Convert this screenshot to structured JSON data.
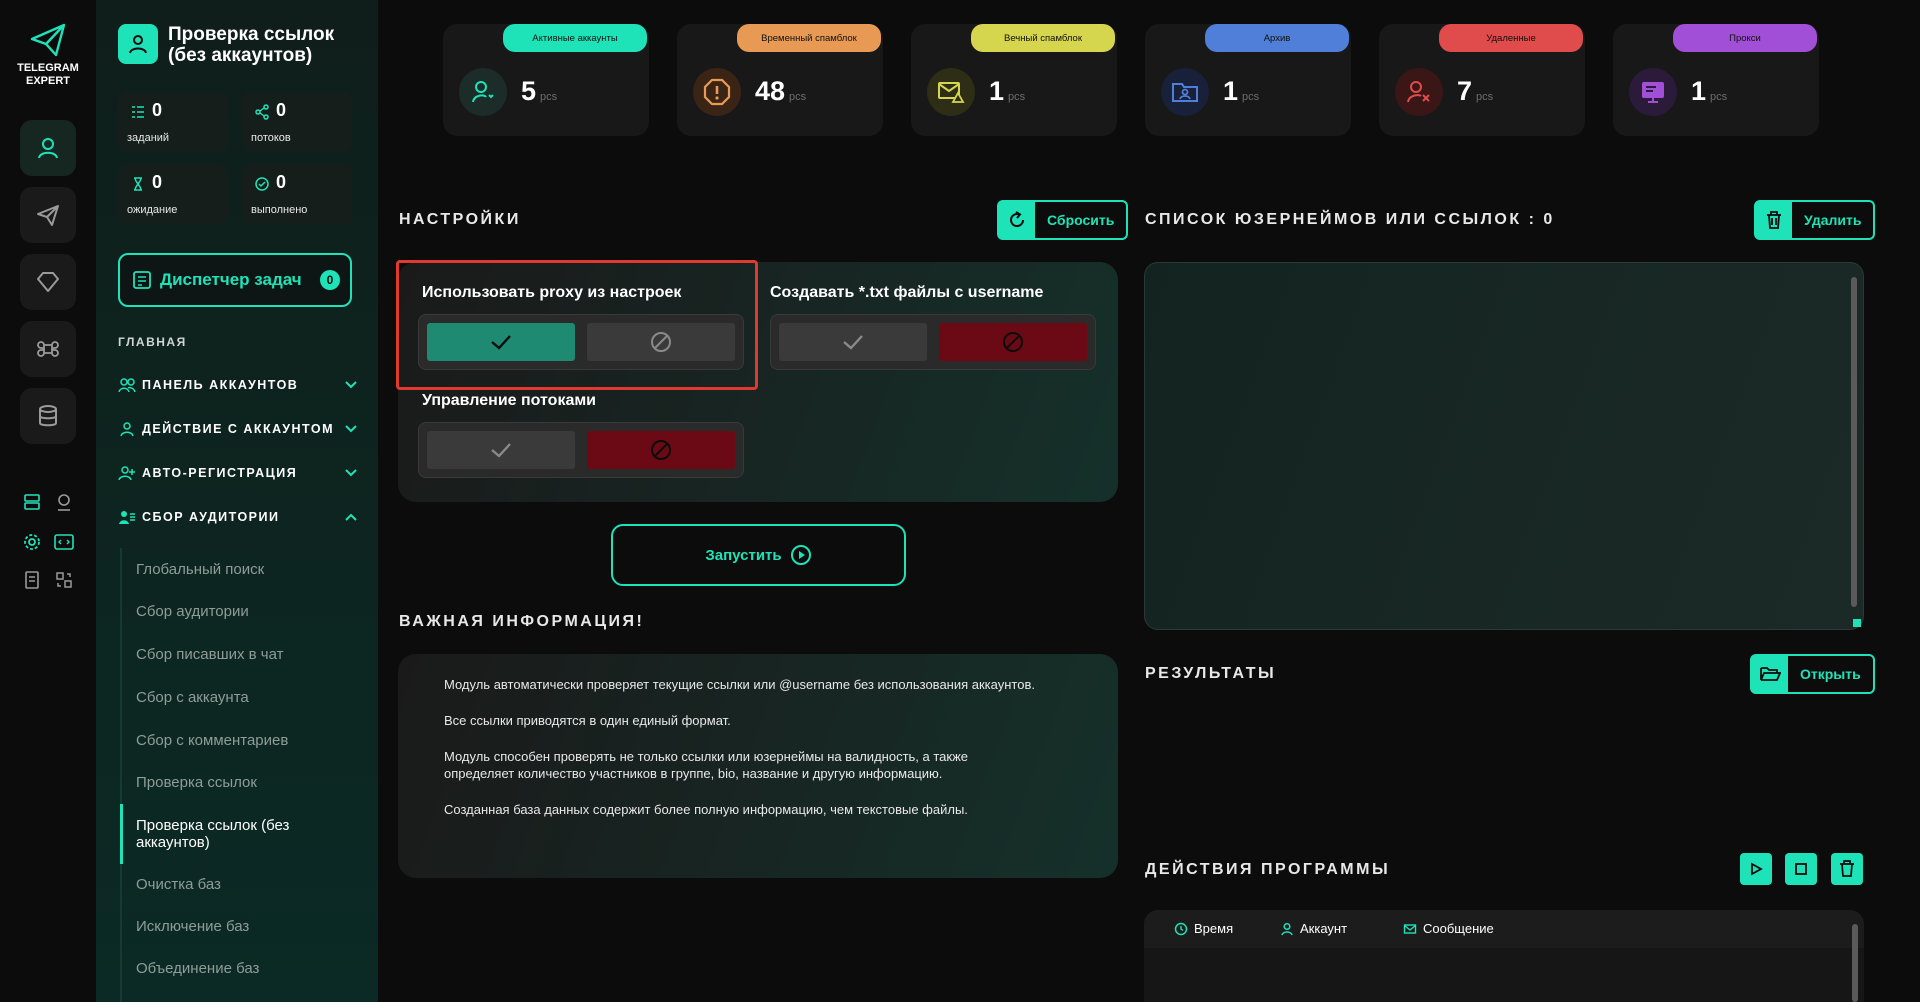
{
  "app": {
    "logo_line1": "TELEGRAM",
    "logo_line2": "EXPERT"
  },
  "header": {
    "title": "Проверка ссылок (без аккаунтов)"
  },
  "stats": [
    {
      "value": "0",
      "label": "заданий",
      "icon": "list-icon"
    },
    {
      "value": "0",
      "label": "потоков",
      "icon": "share-icon"
    },
    {
      "value": "0",
      "label": "ожидание",
      "icon": "hourglass-icon"
    },
    {
      "value": "0",
      "label": "выполнено",
      "icon": "check-circle-icon"
    }
  ],
  "dispatcher": {
    "label": "Диспетчер задач",
    "count": "0"
  },
  "menu": {
    "section": "ГЛАВНАЯ",
    "groups": [
      {
        "label": "ПАНЕЛЬ АККАУНТОВ",
        "expanded": false
      },
      {
        "label": "ДЕЙСТВИЕ С АККАУНТОМ",
        "expanded": false
      },
      {
        "label": "АВТО-РЕГИСТРАЦИЯ",
        "expanded": false
      },
      {
        "label": "СБОР АУДИТОРИИ",
        "expanded": true
      }
    ],
    "subitems": [
      "Глобальный поиск",
      "Сбор аудитории",
      "Сбор писавших в чат",
      "Сбор с аккаунта",
      "Сбор с комментариев",
      "Проверка ссылок",
      "Проверка ссылок (без аккаунтов)",
      "Очистка баз",
      "Исключение баз",
      "Объединение баз"
    ],
    "active_subitem": "Проверка ссылок (без аккаунтов)"
  },
  "cards": [
    {
      "tag": "Активные аккаунты",
      "value": "5",
      "unit": "pcs",
      "color": "#1ee3b8"
    },
    {
      "tag": "Временный спамблок",
      "value": "48",
      "unit": "pcs",
      "color": "#e89a55"
    },
    {
      "tag": "Вечный спамблок",
      "value": "1",
      "unit": "pcs",
      "color": "#d6d64e"
    },
    {
      "tag": "Архив",
      "value": "1",
      "unit": "pcs",
      "color": "#4f7fd8"
    },
    {
      "tag": "Удаленные",
      "value": "7",
      "unit": "pcs",
      "color": "#e04b4b"
    },
    {
      "tag": "Прокси",
      "value": "1",
      "unit": "pcs",
      "color": "#a24fd8"
    }
  ],
  "settings": {
    "title": "НАСТРОЙКИ",
    "reset_label": "Сбросить",
    "options": [
      {
        "label": "Использовать proxy из настроек",
        "state": "on"
      },
      {
        "label": "Создавать *.txt файлы с username",
        "state": "off"
      },
      {
        "label": "Управление потоками",
        "state": "off"
      }
    ]
  },
  "run_label": "Запустить",
  "info": {
    "title": "ВАЖНАЯ ИНФОРМАЦИЯ!",
    "paragraphs": [
      "Модуль автоматически проверяет текущие ссылки или @username без использования аккаунтов.",
      "Все ссылки приводятся в один единый формат.",
      "Модуль способен проверять не только ссылки или юзернеймы на валидность, а также определяет количество участников в группе, bio, название и другую информацию.",
      "Созданная база данных содержит более полную информацию, чем текстовые файлы."
    ]
  },
  "list": {
    "title": "СПИСОК ЮЗЕРНЕЙМОВ ИЛИ ССЫЛОК : 0",
    "delete_label": "Удалить",
    "value": ""
  },
  "results": {
    "title": "РЕЗУЛЬТАТЫ",
    "open_label": "Открыть"
  },
  "actions": {
    "title": "ДЕЙСТВИЯ ПРОГРАММЫ",
    "columns": [
      "Время",
      "Аккаунт",
      "Сообщение"
    ]
  },
  "colors": {
    "accent": "#1ee3b8",
    "danger": "#e03a2f",
    "off_red": "#6b0a14",
    "on_green": "#1e8a72"
  }
}
